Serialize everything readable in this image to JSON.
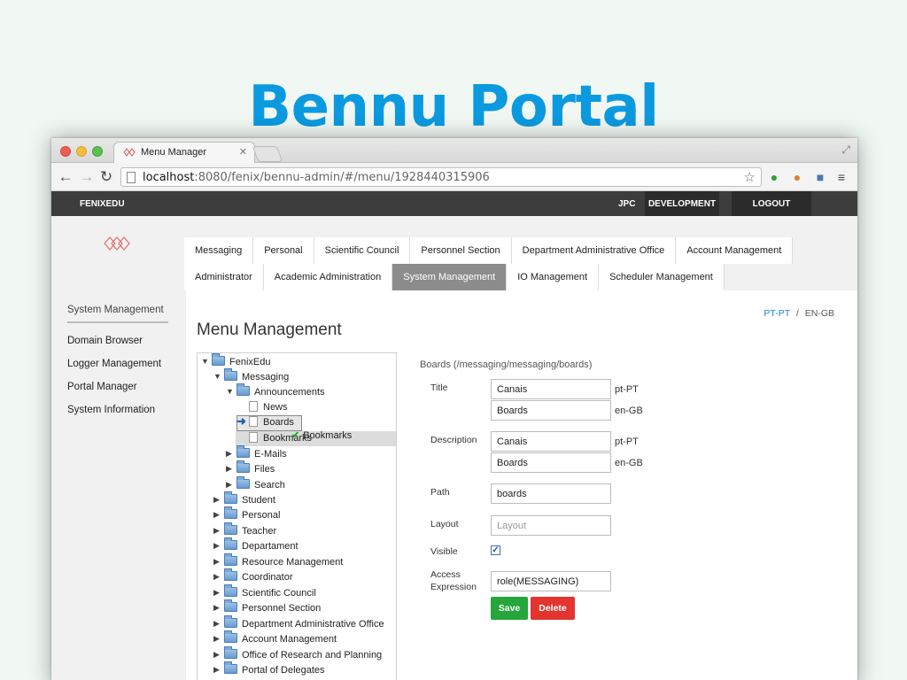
{
  "slide": {
    "title": "Bennu Portal"
  },
  "browser": {
    "tab_title": "Menu Manager",
    "url_host": "localhost",
    "url_rest": ":8080/fenix/bennu-admin/#/menu/1928440315906"
  },
  "appbar": {
    "brand": "FENIXEDU",
    "user": "JPC",
    "environment": "DEVELOPMENT",
    "logout": "LOGOUT"
  },
  "top_menu": {
    "row1": [
      "Messaging",
      "Personal",
      "Scientific Council",
      "Personnel Section",
      "Department Administrative Office",
      "Account Management"
    ],
    "row2": [
      "Administrator",
      "Academic Administration",
      "System Management",
      "IO Management",
      "Scheduler Management"
    ],
    "active": "System Management"
  },
  "sidebar": {
    "heading": "System Management",
    "items": [
      "Domain Browser",
      "Logger Management",
      "Portal Manager",
      "System Information"
    ]
  },
  "content": {
    "lang_pt": "PT-PT",
    "lang_sep": "/",
    "lang_en": "EN-GB",
    "title": "Menu Management"
  },
  "tree": {
    "root": "FenixEdu",
    "messaging": "Messaging",
    "announcements": "Announcements",
    "news": "News",
    "boards": "Boards",
    "bookmarks": "Bookmarks",
    "drop_tip": "Bookmarks",
    "messaging_children": [
      "E-Mails",
      "Files",
      "Search"
    ],
    "root_children": [
      "Student",
      "Personal",
      "Teacher",
      "Departament",
      "Resource Management",
      "Coordinator",
      "Scientific Council",
      "Personnel Section",
      "Department Administrative Office",
      "Account Management",
      "Office of Research and Planning",
      "Portal of Delegates"
    ]
  },
  "form": {
    "heading": "Boards (/messaging/messaging/boards)",
    "title_label": "Title",
    "title_pt": "Canais",
    "title_en": "Boards",
    "description_label": "Description",
    "description_pt": "Canais",
    "description_en": "Boards",
    "lang_pt": "pt-PT",
    "lang_en": "en-GB",
    "path_label": "Path",
    "path_value": "boards",
    "layout_label": "Layout",
    "layout_placeholder": "Layout",
    "visible_label": "Visible",
    "visible_checked": true,
    "access_label_1": "Access",
    "access_label_2": "Expression",
    "access_value": "role(MESSAGING)",
    "save_label": "Save",
    "delete_label": "Delete"
  },
  "colors": {
    "title_blue": "#0b9ae0",
    "save_green": "#24a63b",
    "delete_red": "#e3342f",
    "active_tab": "#8c8c8c"
  }
}
